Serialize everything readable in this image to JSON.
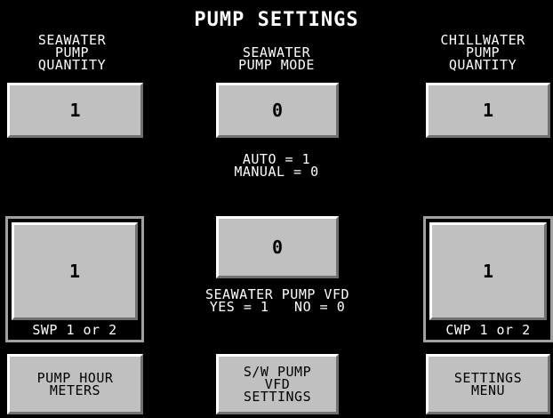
{
  "title": "PUMP SETTINGS",
  "seawater_qty": {
    "label": "SEAWATER\nPUMP\nQUANTITY",
    "value": "1"
  },
  "seawater_mode": {
    "label": "SEAWATER\nPUMP MODE",
    "value": "0",
    "legend": "AUTO = 1\nMANUAL = 0"
  },
  "chillwater_qty": {
    "label": "CHILLWATER\nPUMP\nQUANTITY",
    "value": "1"
  },
  "swp_select": {
    "value": "1",
    "caption": "SWP 1 or 2"
  },
  "vfd": {
    "value": "0",
    "legend": "SEAWATER PUMP VFD\nYES = 1   NO = 0"
  },
  "cwp_select": {
    "value": "1",
    "caption": "CWP 1 or 2"
  },
  "nav": {
    "pump_hour_meters": "PUMP HOUR\nMETERS",
    "sw_pump_vfd_settings": "S/W PUMP\nVFD\nSETTINGS",
    "settings_menu": "SETTINGS\nMENU"
  }
}
